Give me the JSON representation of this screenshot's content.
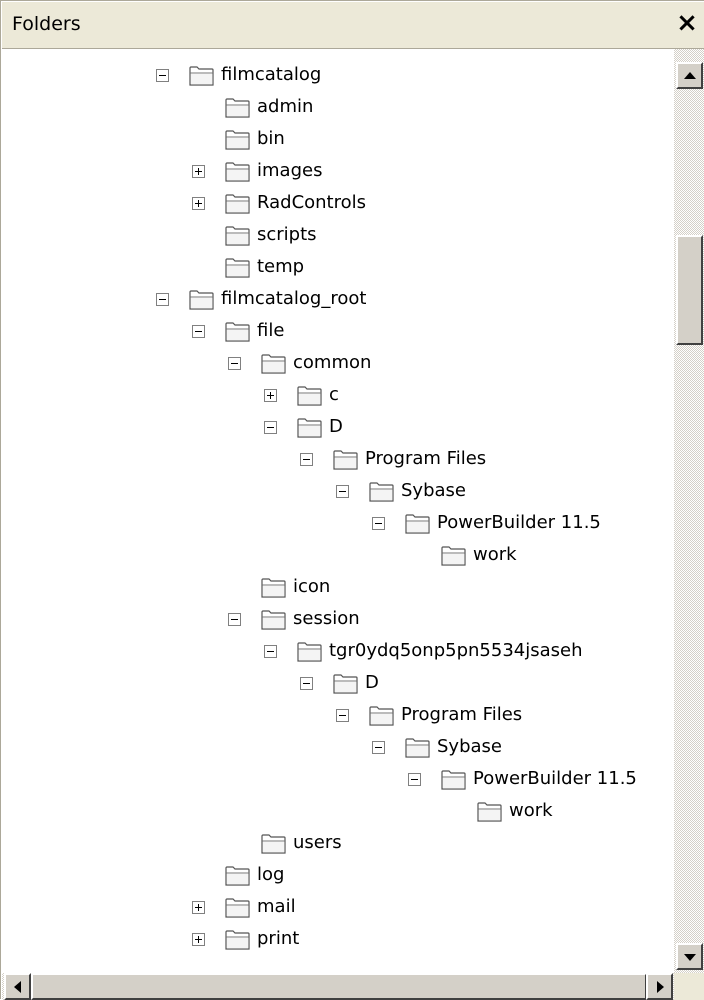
{
  "header": {
    "title": "Folders",
    "close_label": "×"
  },
  "tree": [
    {
      "label": "filmcatalog",
      "level": 0,
      "expander": "minus"
    },
    {
      "label": "admin",
      "level": 1,
      "expander": "none"
    },
    {
      "label": "bin",
      "level": 1,
      "expander": "none"
    },
    {
      "label": "images",
      "level": 1,
      "expander": "plus"
    },
    {
      "label": "RadControls",
      "level": 1,
      "expander": "plus"
    },
    {
      "label": "scripts",
      "level": 1,
      "expander": "none"
    },
    {
      "label": "temp",
      "level": 1,
      "expander": "none"
    },
    {
      "label": "filmcatalog_root",
      "level": 0,
      "expander": "minus"
    },
    {
      "label": "file",
      "level": 1,
      "expander": "minus"
    },
    {
      "label": "common",
      "level": 2,
      "expander": "minus"
    },
    {
      "label": "c",
      "level": 3,
      "expander": "plus"
    },
    {
      "label": "D",
      "level": 3,
      "expander": "minus"
    },
    {
      "label": "Program Files",
      "level": 4,
      "expander": "minus"
    },
    {
      "label": "Sybase",
      "level": 5,
      "expander": "minus"
    },
    {
      "label": "PowerBuilder 11.5",
      "level": 6,
      "expander": "minus"
    },
    {
      "label": "work",
      "level": 7,
      "expander": "none"
    },
    {
      "label": "icon",
      "level": 2,
      "expander": "none"
    },
    {
      "label": "session",
      "level": 2,
      "expander": "minus"
    },
    {
      "label": "tgr0ydq5onp5pn5534jsaseh",
      "level": 3,
      "expander": "minus"
    },
    {
      "label": "D",
      "level": 4,
      "expander": "minus"
    },
    {
      "label": "Program Files",
      "level": 5,
      "expander": "minus"
    },
    {
      "label": "Sybase",
      "level": 6,
      "expander": "minus"
    },
    {
      "label": "PowerBuilder 11.5",
      "level": 7,
      "expander": "minus"
    },
    {
      "label": "work",
      "level": 8,
      "expander": "none"
    },
    {
      "label": "users",
      "level": 2,
      "expander": "none"
    },
    {
      "label": "log",
      "level": 1,
      "expander": "none"
    },
    {
      "label": "mail",
      "level": 1,
      "expander": "plus"
    },
    {
      "label": "print",
      "level": 1,
      "expander": "plus"
    }
  ],
  "icons": {
    "folder": "folder-icon",
    "expand": "plus-box-icon",
    "collapse": "minus-box-icon",
    "close": "close-icon"
  }
}
